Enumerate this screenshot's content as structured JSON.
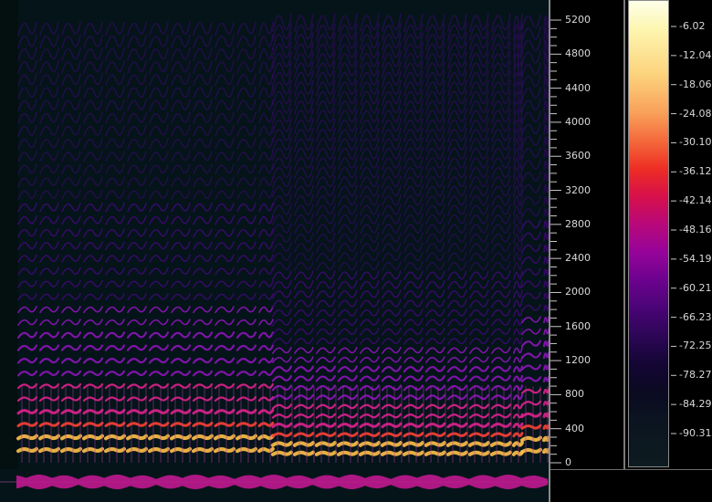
{
  "frequency_axis": {
    "labels": [
      "5200",
      "4800",
      "4400",
      "4000",
      "3600",
      "3200",
      "2800",
      "2400",
      "2000",
      "1600",
      "1200",
      "800",
      "400",
      "0"
    ],
    "max_hz": 5400
  },
  "db_scale": {
    "labels": [
      "-6.02",
      "-12.04",
      "-18.06",
      "-24.08",
      "-30.10",
      "-36.12",
      "-42.14",
      "-48.16",
      "-54.19",
      "-60.21",
      "-66.23",
      "-72.25",
      "-78.27",
      "-84.29",
      "-90.31"
    ]
  },
  "colors": {
    "background": "#041419",
    "harmonic_strong": "#ffc048",
    "harmonic_hot": "#ff4030",
    "harmonic_mid": "#e0208c",
    "harmonic_dim": "#8c14b8",
    "harmonic_faint": "#3a0a6a",
    "waveform": "#c01890"
  },
  "spectrogram": {
    "segments": [
      {
        "start_fraction": 0.0,
        "end_fraction": 0.48,
        "fundamental_hz": 150
      },
      {
        "start_fraction": 0.48,
        "end_fraction": 0.95,
        "fundamental_hz": 110
      },
      {
        "start_fraction": 0.95,
        "end_fraction": 1.0,
        "fundamental_hz": 140
      }
    ]
  }
}
